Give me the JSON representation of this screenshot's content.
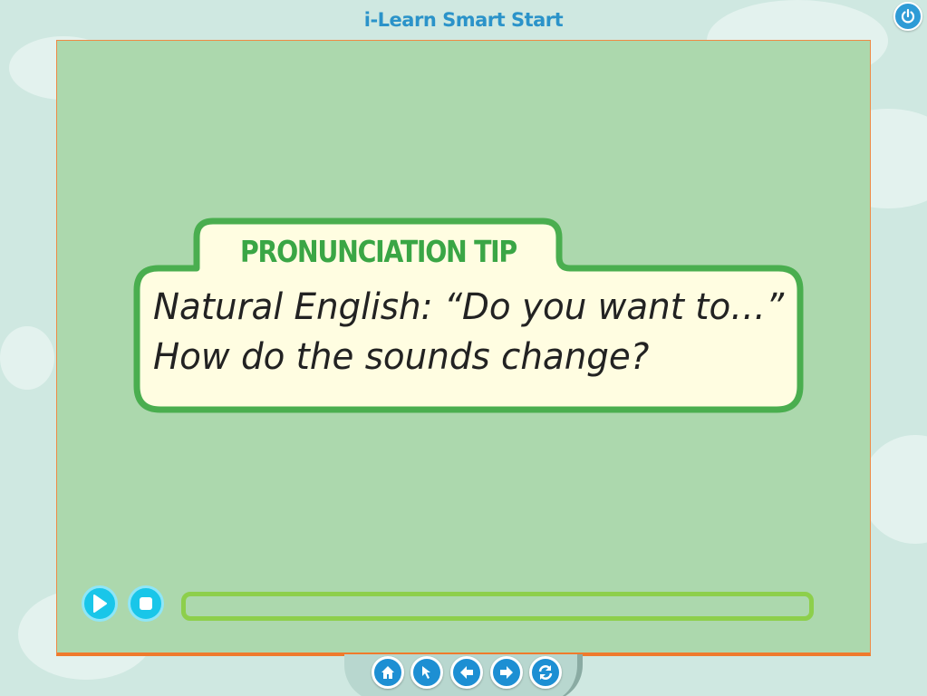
{
  "app": {
    "title": "i-Learn Smart Start"
  },
  "tip": {
    "heading": "PRONUNCIATION TIP",
    "lines": [
      "Natural English: “Do you want to…”",
      "How do the sounds change?"
    ]
  },
  "player": {
    "progress_fraction": 0,
    "controls": [
      "play-icon",
      "stop-icon"
    ]
  },
  "navigation": {
    "buttons": [
      "home-icon",
      "pointer-icon",
      "arrow-left-icon",
      "arrow-right-icon",
      "refresh-icon"
    ]
  },
  "colors": {
    "accent_green": "#3aa645",
    "stage_green": "#acd8ad",
    "card_fill": "#fffde1",
    "player_cyan": "#19c6e9",
    "nav_blue": "#1d8fd3",
    "title_blue": "#2b93c9"
  }
}
